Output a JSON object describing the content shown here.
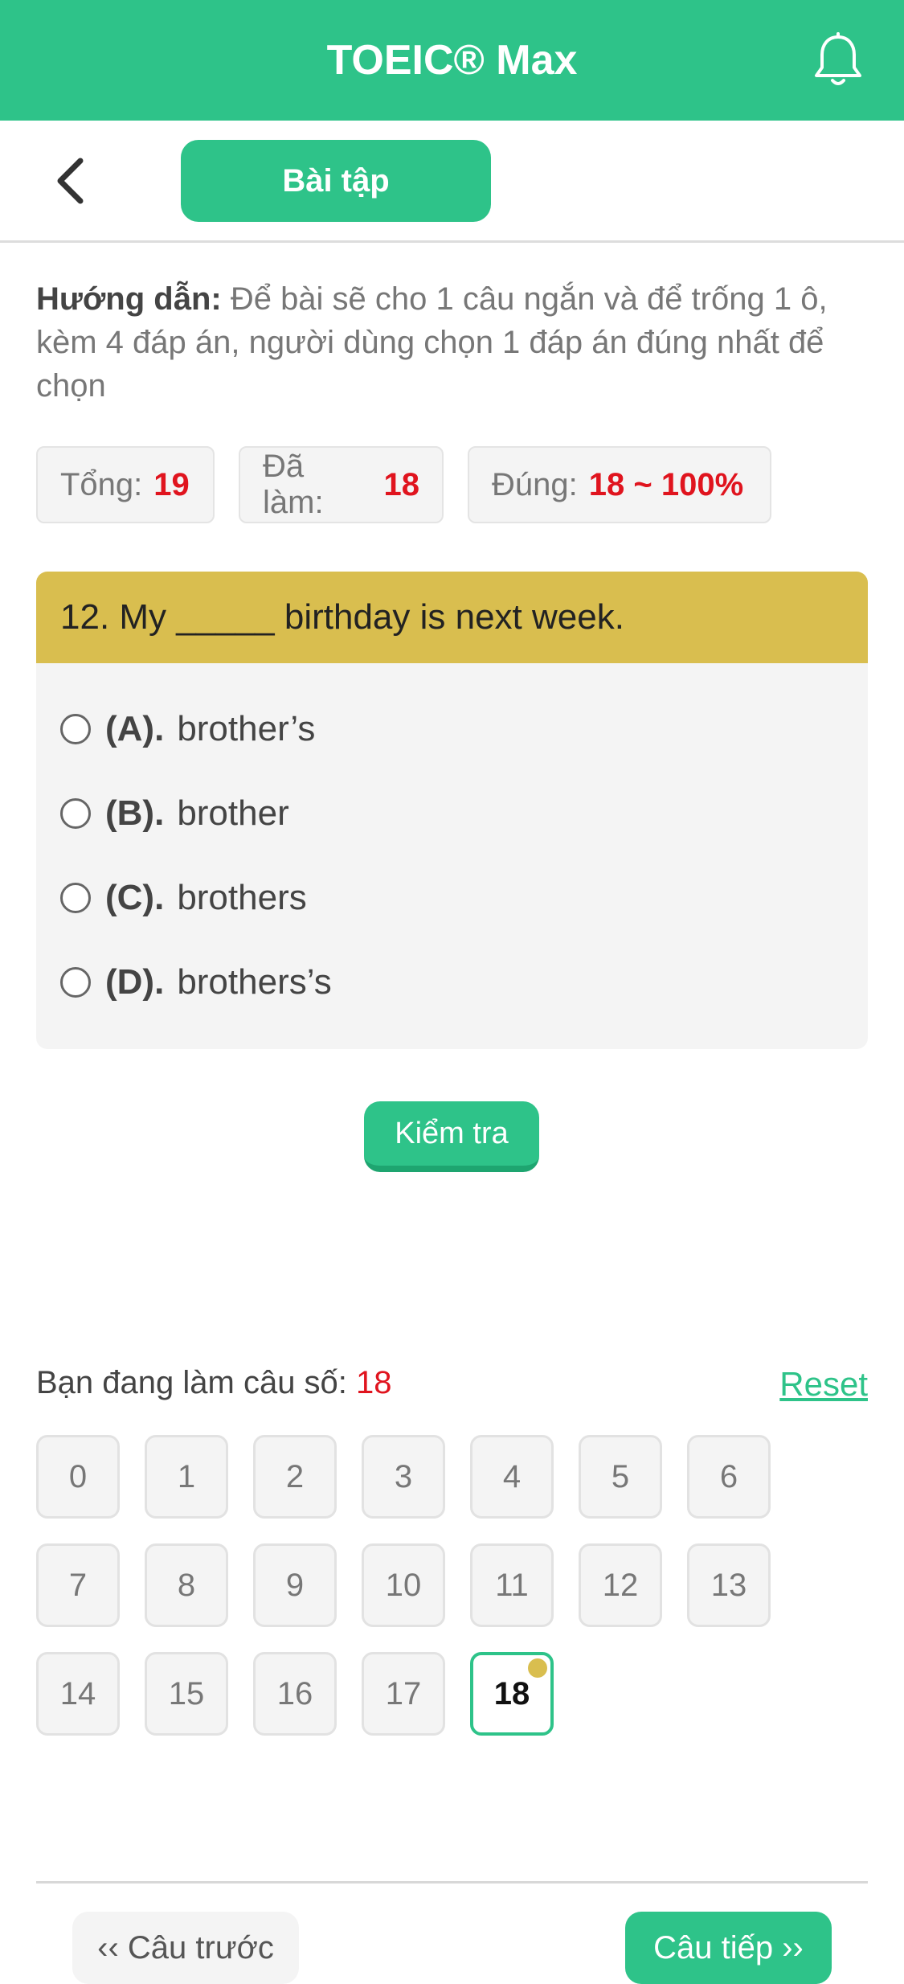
{
  "header": {
    "title": "TOEIC® Max",
    "bell_icon": "bell-icon"
  },
  "nav": {
    "back_icon": "chevron-left-icon",
    "tab_label": "Bài tập"
  },
  "guide": {
    "label": "Hướng dẫn:",
    "text": " Để bài sẽ cho 1 câu ngắn và để trống 1 ô, kèm 4 đáp án, người dùng chọn 1 đáp án đúng nhất để chọn"
  },
  "stats": {
    "total_label": "Tổng:",
    "total_value": "19",
    "done_label": "Đã làm:",
    "done_value": "18",
    "correct_label": "Đúng:",
    "correct_value": "18 ~ 100%"
  },
  "question": {
    "text": "12. My _____ birthday is next week.",
    "options": [
      {
        "key": "(A).",
        "text": "brother’s"
      },
      {
        "key": "(B).",
        "text": "brother"
      },
      {
        "key": "(C).",
        "text": "brothers"
      },
      {
        "key": "(D).",
        "text": "brothers’s"
      }
    ]
  },
  "check_button": "Kiểm tra",
  "progress": {
    "label": "Bạn đang làm câu số:",
    "current": "18",
    "reset_label": "Reset",
    "numbers": [
      "0",
      "1",
      "2",
      "3",
      "4",
      "5",
      "6",
      "7",
      "8",
      "9",
      "10",
      "11",
      "12",
      "13",
      "14",
      "15",
      "16",
      "17",
      "18"
    ]
  },
  "footer": {
    "prev_label": "‹‹ Câu trước",
    "next_label": "Câu tiếp ››"
  },
  "colors": {
    "primary": "#2ec389",
    "question_header": "#d9be4f",
    "highlight": "#e0141e"
  }
}
